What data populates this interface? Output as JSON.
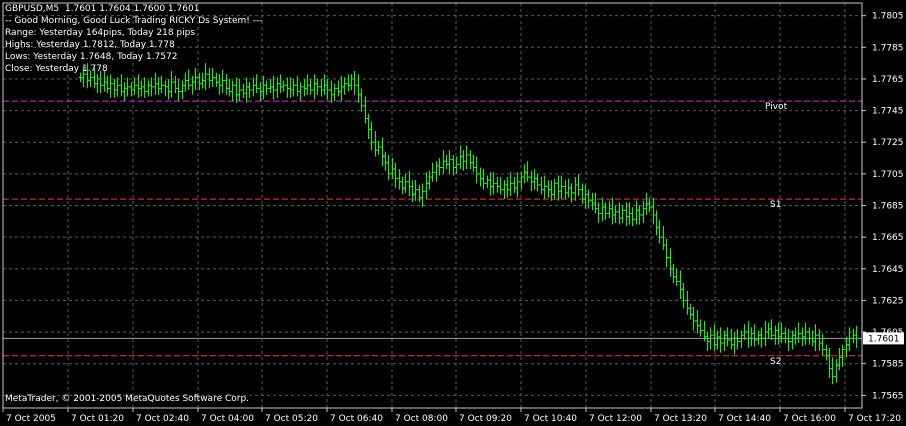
{
  "header": {
    "symbol_line": "GBPUSD,M5  1.7601 1.7604 1.7600 1.7601",
    "greeting": "-- Good Morning, Good Luck Trading RICKY Ds System! ---",
    "range": "Range: Yesterday 164pips, Today 218 pips",
    "highs": "Highs: Yesterday 1.7812, Today 1.778",
    "lows": "Lows: Yesterday 1.7648, Today 1.7572",
    "close": "Close: Yesterday 1.778"
  },
  "footer": {
    "copyright": "MetaTrader, © 2001-2005 MetaQuotes Software Corp."
  },
  "current_price_label": "1.7601",
  "colors": {
    "bars": "#00ff00",
    "grid": "#5a5a5a",
    "pivot": "#c43ac4",
    "support": "#ff3030",
    "current": "#ffffff"
  },
  "chart_data": {
    "type": "line",
    "subtype": "ohlc-bars",
    "title": "GBPUSD,M5",
    "ylim": [
      1.7557,
      1.7813
    ],
    "yticks": [
      "1.7805",
      "1.7785",
      "1.7765",
      "1.7745",
      "1.7725",
      "1.7705",
      "1.7685",
      "1.7665",
      "1.7645",
      "1.7625",
      "1.7605",
      "1.7585",
      "1.7565"
    ],
    "xticks": [
      "7 Oct 2005",
      "7 Oct 01:20",
      "7 Oct 02:40",
      "7 Oct 04:00",
      "7 Oct 05:20",
      "7 Oct 06:40",
      "7 Oct 08:00",
      "7 Oct 09:20",
      "7 Oct 10:40",
      "7 Oct 12:00",
      "7 Oct 13:20",
      "7 Oct 14:40",
      "7 Oct 16:00",
      "7 Oct 17:20"
    ],
    "levels": [
      {
        "name": "Pivot",
        "value": 1.7751,
        "color": "#c43ac4"
      },
      {
        "name": "S1",
        "value": 1.7689,
        "color": "#ff3030"
      },
      {
        "name": "S2",
        "value": 1.759,
        "color": "#ff3030"
      }
    ],
    "current_price": 1.7601,
    "close_series": [
      1.7766,
      1.7768,
      1.7764,
      1.7766,
      1.7762,
      1.7765,
      1.7761,
      1.7763,
      1.7759,
      1.7762,
      1.7758,
      1.7761,
      1.7757,
      1.7759,
      1.776,
      1.7758,
      1.7761,
      1.7759,
      1.776,
      1.7757,
      1.7761,
      1.776,
      1.7762,
      1.7759,
      1.7761,
      1.776,
      1.7757,
      1.7763,
      1.7759,
      1.7757,
      1.7761,
      1.7764,
      1.7761,
      1.7763,
      1.7766,
      1.7762,
      1.7764,
      1.7768,
      1.7764,
      1.7766,
      1.7763,
      1.7761,
      1.7764,
      1.7759,
      1.7757,
      1.7761,
      1.7755,
      1.7758,
      1.7756,
      1.776,
      1.7758,
      1.7761,
      1.7759,
      1.7757,
      1.7761,
      1.7759,
      1.776,
      1.7758,
      1.7762,
      1.776,
      1.7761,
      1.7759,
      1.7758,
      1.7761,
      1.7757,
      1.776,
      1.7759,
      1.7761,
      1.7758,
      1.7762,
      1.776,
      1.7758,
      1.7761,
      1.7758,
      1.7755,
      1.7759,
      1.7757,
      1.776,
      1.7762,
      1.7761,
      1.7765,
      1.7761,
      1.7755,
      1.7748,
      1.774,
      1.7733,
      1.7725,
      1.772,
      1.7722,
      1.7716,
      1.7712,
      1.7705,
      1.7708,
      1.7702,
      1.77,
      1.7696,
      1.77,
      1.7697,
      1.7692,
      1.7695,
      1.769,
      1.7694,
      1.7699,
      1.7703,
      1.7706,
      1.771,
      1.7709,
      1.7713,
      1.7711,
      1.7714,
      1.7709,
      1.7711,
      1.7716,
      1.7713,
      1.7717,
      1.7712,
      1.7709,
      1.7705,
      1.7702,
      1.7699,
      1.7701,
      1.7697,
      1.7699,
      1.7697,
      1.7695,
      1.7698,
      1.7695,
      1.7699,
      1.7696,
      1.77,
      1.7703,
      1.7706,
      1.7703,
      1.77,
      1.7702,
      1.7698,
      1.7695,
      1.7697,
      1.7695,
      1.7692,
      1.7699,
      1.7694,
      1.7697,
      1.7693,
      1.7696,
      1.7693,
      1.7698,
      1.7695,
      1.7689,
      1.7692,
      1.7688,
      1.7686,
      1.7683,
      1.768,
      1.7684,
      1.768,
      1.7683,
      1.7679,
      1.7681,
      1.7677,
      1.7682,
      1.7678,
      1.768,
      1.7676,
      1.7682,
      1.7679,
      1.7683,
      1.7686,
      1.7684,
      1.7679,
      1.7671,
      1.7665,
      1.766,
      1.7652,
      1.7645,
      1.764,
      1.7637,
      1.7632,
      1.7625,
      1.762,
      1.7616,
      1.7612,
      1.7609,
      1.7606,
      1.7602,
      1.7599,
      1.7603,
      1.7597,
      1.7602,
      1.7598,
      1.7603,
      1.76,
      1.7597,
      1.7601,
      1.7599,
      1.7603,
      1.7605,
      1.7601,
      1.7604,
      1.76,
      1.7603,
      1.7601,
      1.7605,
      1.7607,
      1.7603,
      1.7606,
      1.7602,
      1.7604,
      1.7601,
      1.7599,
      1.7603,
      1.7601,
      1.7604,
      1.7602,
      1.7605,
      1.7601,
      1.7599,
      1.7603,
      1.7598,
      1.7594,
      1.759,
      1.7582,
      1.7577,
      1.7584,
      1.7589,
      1.7594,
      1.7597,
      1.7601,
      1.7603,
      1.7601
    ]
  }
}
